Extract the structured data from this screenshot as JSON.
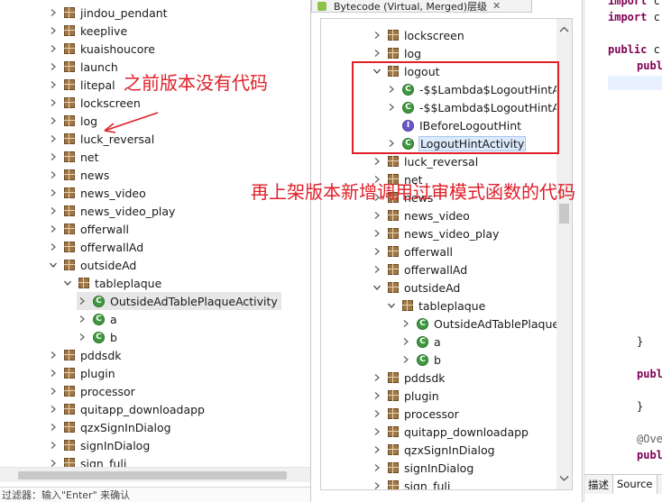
{
  "left_tree": {
    "items": [
      {
        "label": "jindou_pendant",
        "type": "package",
        "twisty": "collapsed",
        "indent": 0
      },
      {
        "label": "keeplive",
        "type": "package",
        "twisty": "collapsed",
        "indent": 0
      },
      {
        "label": "kuaishoucore",
        "type": "package",
        "twisty": "collapsed",
        "indent": 0
      },
      {
        "label": "launch",
        "type": "package",
        "twisty": "collapsed",
        "indent": 0
      },
      {
        "label": "litepal",
        "type": "package",
        "twisty": "collapsed",
        "indent": 0
      },
      {
        "label": "lockscreen",
        "type": "package",
        "twisty": "collapsed",
        "indent": 0
      },
      {
        "label": "log",
        "type": "package",
        "twisty": "collapsed",
        "indent": 0
      },
      {
        "label": "luck_reversal",
        "type": "package",
        "twisty": "collapsed",
        "indent": 0
      },
      {
        "label": "net",
        "type": "package",
        "twisty": "collapsed",
        "indent": 0
      },
      {
        "label": "news",
        "type": "package",
        "twisty": "collapsed",
        "indent": 0
      },
      {
        "label": "news_video",
        "type": "package",
        "twisty": "collapsed",
        "indent": 0
      },
      {
        "label": "news_video_play",
        "type": "package",
        "twisty": "collapsed",
        "indent": 0
      },
      {
        "label": "offerwall",
        "type": "package",
        "twisty": "collapsed",
        "indent": 0
      },
      {
        "label": "offerwallAd",
        "type": "package",
        "twisty": "collapsed",
        "indent": 0
      },
      {
        "label": "outsideAd",
        "type": "package",
        "twisty": "expanded",
        "indent": 0
      },
      {
        "label": "tableplaque",
        "type": "package",
        "twisty": "expanded",
        "indent": 1
      },
      {
        "label": "OutsideAdTablePlaqueActivity",
        "type": "class",
        "twisty": "collapsed",
        "indent": 2,
        "selected": true
      },
      {
        "label": "a",
        "type": "class",
        "twisty": "collapsed",
        "indent": 2
      },
      {
        "label": "b",
        "type": "class",
        "twisty": "collapsed",
        "indent": 2
      },
      {
        "label": "pddsdk",
        "type": "package",
        "twisty": "collapsed",
        "indent": 0
      },
      {
        "label": "plugin",
        "type": "package",
        "twisty": "collapsed",
        "indent": 0
      },
      {
        "label": "processor",
        "type": "package",
        "twisty": "collapsed",
        "indent": 0
      },
      {
        "label": "quitapp_downloadapp",
        "type": "package",
        "twisty": "collapsed",
        "indent": 0
      },
      {
        "label": "qzxSignInDialog",
        "type": "package",
        "twisty": "collapsed",
        "indent": 0
      },
      {
        "label": "signInDialog",
        "type": "package",
        "twisty": "collapsed",
        "indent": 0
      },
      {
        "label": "sign_fuli",
        "type": "package",
        "twisty": "collapsed",
        "indent": 0
      }
    ],
    "filter_label": "过滤器：输入\"Enter\" 来确认"
  },
  "mid_panel": {
    "tab_title": "Bytecode (Virtual, Merged)层级",
    "tab_close": "✕",
    "items": [
      {
        "label": "lockscreen",
        "type": "package",
        "twisty": "collapsed",
        "indent": 0
      },
      {
        "label": "log",
        "type": "package",
        "twisty": "collapsed",
        "indent": 0
      },
      {
        "label": "logout",
        "type": "package",
        "twisty": "expanded",
        "indent": 0
      },
      {
        "label": "-$$Lambda$LogoutHintAc",
        "type": "class",
        "twisty": "collapsed",
        "indent": 1
      },
      {
        "label": "-$$Lambda$LogoutHintAc",
        "type": "class",
        "twisty": "collapsed",
        "indent": 1
      },
      {
        "label": "IBeforeLogoutHint",
        "type": "interface",
        "twisty": "none",
        "indent": 1
      },
      {
        "label": "LogoutHintActivity",
        "type": "class",
        "twisty": "collapsed",
        "indent": 1,
        "selected": true
      },
      {
        "label": "luck_reversal",
        "type": "package",
        "twisty": "collapsed",
        "indent": 0
      },
      {
        "label": "net",
        "type": "package",
        "twisty": "collapsed",
        "indent": 0
      },
      {
        "label": "news",
        "type": "package",
        "twisty": "collapsed",
        "indent": 0
      },
      {
        "label": "news_video",
        "type": "package",
        "twisty": "collapsed",
        "indent": 0
      },
      {
        "label": "news_video_play",
        "type": "package",
        "twisty": "collapsed",
        "indent": 0
      },
      {
        "label": "offerwall",
        "type": "package",
        "twisty": "collapsed",
        "indent": 0
      },
      {
        "label": "offerwallAd",
        "type": "package",
        "twisty": "collapsed",
        "indent": 0
      },
      {
        "label": "outsideAd",
        "type": "package",
        "twisty": "expanded",
        "indent": 0
      },
      {
        "label": "tableplaque",
        "type": "package",
        "twisty": "expanded",
        "indent": 1
      },
      {
        "label": "OutsideAdTablePlaqueA",
        "type": "class",
        "twisty": "collapsed",
        "indent": 2
      },
      {
        "label": "a",
        "type": "class",
        "twisty": "collapsed",
        "indent": 2
      },
      {
        "label": "b",
        "type": "class",
        "twisty": "collapsed",
        "indent": 2
      },
      {
        "label": "pddsdk",
        "type": "package",
        "twisty": "collapsed",
        "indent": 0
      },
      {
        "label": "plugin",
        "type": "package",
        "twisty": "collapsed",
        "indent": 0
      },
      {
        "label": "processor",
        "type": "package",
        "twisty": "collapsed",
        "indent": 0
      },
      {
        "label": "quitapp_downloadapp",
        "type": "package",
        "twisty": "collapsed",
        "indent": 0
      },
      {
        "label": "qzxSignInDialog",
        "type": "package",
        "twisty": "collapsed",
        "indent": 0
      },
      {
        "label": "signInDialog",
        "type": "package",
        "twisty": "collapsed",
        "indent": 0
      },
      {
        "label": "sign_fuli",
        "type": "package",
        "twisty": "collapsed",
        "indent": 0
      }
    ]
  },
  "code_panel": {
    "lines": [
      {
        "kw": "import",
        "rest": " c"
      },
      {
        "kw": "import",
        "rest": " c"
      },
      {
        "kw": "public",
        "rest": " c"
      },
      {
        "kw": "publ",
        "rest": ""
      },
      {
        "kw": "",
        "rest": "}"
      },
      {
        "kw": "publ",
        "rest": ""
      },
      {
        "kw": "",
        "rest": "}"
      },
      {
        "kw": "",
        "rest": "@Ove"
      },
      {
        "kw": "publ",
        "rest": ""
      }
    ],
    "tab_describe": "描述",
    "tab_source": "Source"
  },
  "annotations": {
    "note_old": "之前版本没有代码",
    "note_new": "再上架版本新增调用过审模式函数的代码",
    "color": "#e0202a"
  },
  "colors": {
    "package_icon": "#a07848",
    "class_icon": "#3f9a3f",
    "interface_icon": "#6b55c8",
    "keyword": "#7f0055",
    "selection": "#dbe9fb"
  }
}
